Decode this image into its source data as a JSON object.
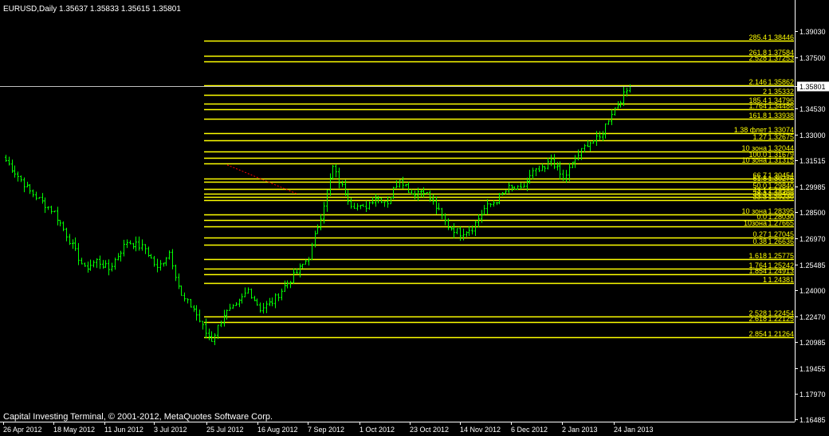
{
  "header": {
    "symbol_line": "EURUSD,Daily  1.35637 1.35833 1.35615 1.35801"
  },
  "footer": {
    "copyright": "Capital Investing Terminal, © 2001-2012, MetaQuotes Software Corp."
  },
  "colors": {
    "background": "#000000",
    "candle": "#00ff00",
    "level_line": "#ffff00",
    "axis": "#ffffff",
    "ask_line": "#c0c0c0",
    "trend_line": "#ff0000"
  },
  "chart_data": {
    "type": "candlestick",
    "title": "EURUSD,Daily",
    "ohlc_readout": [
      "1.35637",
      "1.35833",
      "1.35615",
      "1.35801"
    ],
    "current_price": "1.35801",
    "ylim": [
      1.1635,
      1.4068
    ],
    "y_ticks": [
      "1.39030",
      "1.37500",
      "1.35801",
      "1.34530",
      "1.33000",
      "1.31515",
      "1.29985",
      "1.28500",
      "1.26970",
      "1.25485",
      "1.24000",
      "1.22470",
      "1.20985",
      "1.19455",
      "1.17970",
      "1.16485"
    ],
    "x_ticks": [
      "26 Apr 2012",
      "18 May 2012",
      "11 Jun 2012",
      "3 Jul 2012",
      "25 Jul 2012",
      "16 Aug 2012",
      "7 Sep 2012",
      "1 Oct 2012",
      "23 Oct 2012",
      "14 Nov 2012",
      "6 Dec 2012",
      "2 Jan 2013",
      "24 Jan 2013"
    ],
    "close_path": [
      [
        0,
        1.315
      ],
      [
        8,
        1.297
      ],
      [
        16,
        1.285
      ],
      [
        20,
        1.272
      ],
      [
        26,
        1.252
      ],
      [
        30,
        1.257
      ],
      [
        34,
        1.252
      ],
      [
        40,
        1.268
      ],
      [
        46,
        1.264
      ],
      [
        50,
        1.252
      ],
      [
        54,
        1.262
      ],
      [
        58,
        1.236
      ],
      [
        62,
        1.229
      ],
      [
        66,
        1.215
      ],
      [
        68,
        1.211
      ],
      [
        72,
        1.226
      ],
      [
        76,
        1.23
      ],
      [
        80,
        1.24
      ],
      [
        84,
        1.229
      ],
      [
        88,
        1.233
      ],
      [
        92,
        1.242
      ],
      [
        96,
        1.25
      ],
      [
        100,
        1.259
      ],
      [
        104,
        1.283
      ],
      [
        108,
        1.311
      ],
      [
        110,
        1.303
      ],
      [
        114,
        1.29
      ],
      [
        118,
        1.287
      ],
      [
        122,
        1.294
      ],
      [
        126,
        1.291
      ],
      [
        130,
        1.305
      ],
      [
        134,
        1.296
      ],
      [
        138,
        1.298
      ],
      [
        142,
        1.288
      ],
      [
        146,
        1.277
      ],
      [
        150,
        1.273
      ],
      [
        154,
        1.276
      ],
      [
        158,
        1.287
      ],
      [
        162,
        1.292
      ],
      [
        166,
        1.299
      ],
      [
        170,
        1.298
      ],
      [
        174,
        1.308
      ],
      [
        178,
        1.31
      ],
      [
        180,
        1.316
      ],
      [
        184,
        1.304
      ],
      [
        188,
        1.316
      ],
      [
        192,
        1.325
      ],
      [
        196,
        1.328
      ],
      [
        200,
        1.343
      ],
      [
        204,
        1.353
      ],
      [
        206,
        1.358
      ]
    ],
    "levels": [
      {
        "ratio": "285.4",
        "price": 1.38446,
        "label": "1.38446"
      },
      {
        "ratio": "261.8",
        "price": 1.37584,
        "label": "1.37584"
      },
      {
        "ratio": "2.528",
        "price": 1.37253,
        "label": "1.37253"
      },
      {
        "ratio": "2.146",
        "price": 1.35862,
        "label": "1.35862"
      },
      {
        "ratio": "2",
        "price": 1.35332,
        "label": "1.35332"
      },
      {
        "ratio": "185.4",
        "price": 1.34796,
        "label": "1.34796"
      },
      {
        "ratio": "1.764",
        "price": 1.34486,
        "label": "1.34486"
      },
      {
        "ratio": "161.8",
        "price": 1.33938,
        "label": "1.33938"
      },
      {
        "ratio": "1.38 флет",
        "price": 1.33074,
        "label": "1.33074"
      },
      {
        "ratio": "1.27",
        "price": 1.32675,
        "label": "1.32675"
      },
      {
        "ratio": "10 зона",
        "price": 1.32044,
        "label": "1.32044"
      },
      {
        "ratio": "100.0",
        "price": 1.31679,
        "label": "1.31679"
      },
      {
        "ratio": "10 зона",
        "price": 1.31315,
        "label": "1.31315"
      },
      {
        "ratio": "66.7",
        "price": 1.30454,
        "label": "1.30454"
      },
      {
        "ratio": "61.8",
        "price": 1.30275,
        "label": "1.30275"
      },
      {
        "ratio": "50.0",
        "price": 1.2984,
        "label": "1.29840"
      },
      {
        "ratio": "43.1",
        "price": 1.29588,
        "label": "1.29588"
      },
      {
        "ratio": "38.2",
        "price": 1.29409,
        "label": "1.29409"
      },
      {
        "ratio": "33.3",
        "price": 1.2923,
        "label": "1.29230"
      },
      {
        "ratio": "10 зона",
        "price": 1.28395,
        "label": "1.28395"
      },
      {
        "ratio": "0.0",
        "price": 1.2803,
        "label": "1.28030"
      },
      {
        "ratio": "10зона",
        "price": 1.27665,
        "label": "1.27665"
      },
      {
        "ratio": "0.27",
        "price": 1.27045,
        "label": "1.27045"
      },
      {
        "ratio": "0.38",
        "price": 1.26636,
        "label": "1.26636"
      },
      {
        "ratio": "1.618",
        "price": 1.25775,
        "label": "1.25775"
      },
      {
        "ratio": "1.764",
        "price": 1.25242,
        "label": "1.25242"
      },
      {
        "ratio": "1.854",
        "price": 1.24913,
        "label": "1.24913"
      },
      {
        "ratio": "1",
        "price": 1.24381,
        "label": "1.24381"
      },
      {
        "ratio": "2.528",
        "price": 1.22454,
        "label": "1.22454"
      },
      {
        "ratio": "2.618",
        "price": 1.22125,
        "label": "1.22125"
      },
      {
        "ratio": "2.854",
        "price": 1.21264,
        "label": "1.21264"
      }
    ]
  }
}
